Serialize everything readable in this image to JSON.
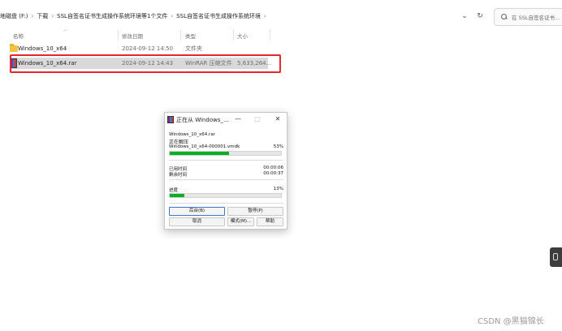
{
  "address_bar": {
    "crumbs": [
      "地磁盘 (F:)",
      "下载",
      "SSL自签名证书生成操作系统环境等1个文件",
      "SSL自签名证书生成操作系统环境"
    ],
    "separator": "›",
    "dropdown_glyph": "⌄",
    "refresh_glyph": "↻",
    "search_placeholder": "在 SSL自签名证书..."
  },
  "columns": {
    "name": "名称",
    "date": "修改日期",
    "type": "类型",
    "size": "大小"
  },
  "files": [
    {
      "name": "Windows_10_x64",
      "date": "2024-09-12 14:50",
      "type": "文件夹",
      "size": "",
      "icon": "folder-icon"
    },
    {
      "name": "Windows_10_x64.rar",
      "date": "2024-09-12 14:43",
      "type": "WinRAR 压缩文件",
      "size": "5,633,264...",
      "icon": "rar-icon"
    }
  ],
  "dialog": {
    "title": "正在从 Windows_...",
    "min_glyph": "—",
    "max_glyph": "□",
    "close_glyph": "✕",
    "archive_name": "Windows_10_x64.rar",
    "status": "正在解压",
    "current_file": "Windows_10_x64-000001.vmdk",
    "file_percent_text": "53%",
    "file_progress": 0.53,
    "elapsed_label": "已用时间",
    "elapsed_value": "00:00:06",
    "remaining_label": "剩余时间",
    "remaining_value": "00:00:37",
    "progress_label": "进度",
    "total_percent_text": "13%",
    "total_progress": 0.13,
    "buttons": {
      "background": "后台(B)",
      "pause": "暂停(P)",
      "cancel": "取消",
      "mode": "模式(M)...",
      "help": "帮助"
    }
  },
  "watermark": "CSDN @黑猫锦长",
  "colors": {
    "progress_fill": "#06b025",
    "highlight_border": "#e8262b"
  }
}
